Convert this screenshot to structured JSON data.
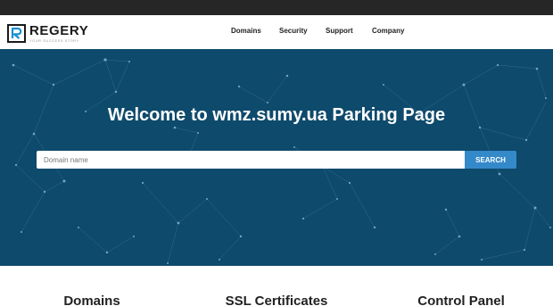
{
  "brand": {
    "name": "REGERY",
    "tagline": "YOUR SUCCESS STORY",
    "accent_color": "#1a8fd0"
  },
  "nav": {
    "items": [
      {
        "label": "Domains"
      },
      {
        "label": "Security"
      },
      {
        "label": "Support"
      },
      {
        "label": "Company"
      }
    ]
  },
  "hero": {
    "title": "Welcome to wmz.sumy.ua Parking Page",
    "background_color": "#0e4a6c"
  },
  "search": {
    "placeholder": "Domain name",
    "button_label": "SEARCH",
    "button_color": "#3489c9"
  },
  "features": {
    "items": [
      {
        "title": "Domains"
      },
      {
        "title": "SSL Certificates"
      },
      {
        "title": "Control Panel"
      }
    ]
  }
}
